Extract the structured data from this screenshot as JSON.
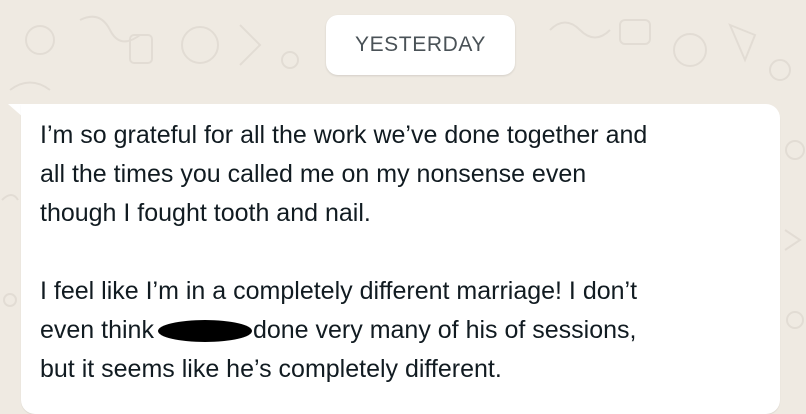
{
  "chat": {
    "date_separator": "YESTERDAY",
    "message": {
      "line1": "I’m so grateful for all the work we’ve done together and",
      "line2": "all the times you called me on my nonsense even",
      "line3": "though I fought tooth and nail.",
      "line4": "I feel like I’m in a completely different marriage! I don’t",
      "line5_before": "even think",
      "line5_after": "done very many of his of sessions,",
      "line6": "but it seems like he’s completely different."
    }
  },
  "colors": {
    "wallpaper": "#efeae2",
    "bubble": "#ffffff",
    "text": "#111b21",
    "pill_text": "#4a5257"
  }
}
